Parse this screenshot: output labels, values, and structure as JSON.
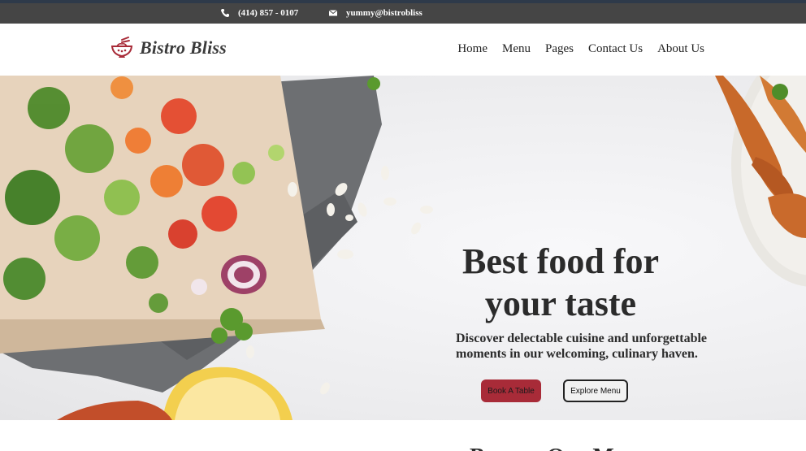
{
  "topbar": {
    "phone": "(414) 857 - 0107",
    "email": "yummy@bistrobliss",
    "phone_icon": "phone-icon",
    "email_icon": "envelope-icon"
  },
  "header": {
    "brand": "Bistro Bliss",
    "logo_icon": "bowl-chopsticks-icon",
    "nav": [
      "Home",
      "Menu",
      "Pages",
      "Contact Us",
      "About Us"
    ]
  },
  "hero": {
    "title_line1": "Best food for",
    "title_line2": "your taste",
    "subtitle_line1": "Discover delectable cuisine and unforgettable",
    "subtitle_line2": "moments in our welcoming, culinary haven.",
    "book_button": "Book A Table",
    "explore_button": "Explore Menu"
  },
  "next_section": {
    "title": "Browse Our Menu"
  },
  "colors": {
    "topbar_bg": "#454545",
    "accent": "#a82b38",
    "text_dark": "#2b2b2b"
  }
}
